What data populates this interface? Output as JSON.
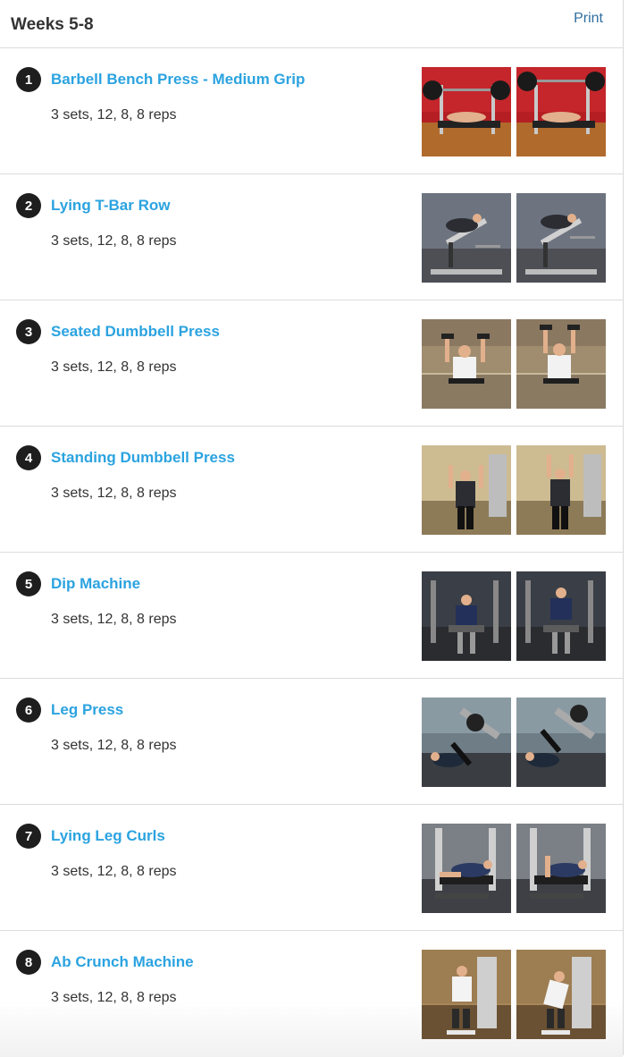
{
  "header": {
    "title": "Weeks 5-8",
    "print_label": "Print"
  },
  "exercises": [
    {
      "number": "1",
      "name": "Barbell Bench Press - Medium Grip",
      "detail": "3 sets, 12, 8, 8 reps",
      "scene": "bench",
      "bg": "#b51f24",
      "floor": "#b06a2c"
    },
    {
      "number": "2",
      "name": "Lying T-Bar Row",
      "detail": "3 sets, 12, 8, 8 reps",
      "scene": "tbar",
      "bg": "#6d7480",
      "floor": "#4d4f55"
    },
    {
      "number": "3",
      "name": "Seated Dumbbell Press",
      "detail": "3 sets, 12, 8, 8 reps",
      "scene": "seated",
      "bg": "#c9b89a",
      "floor": "#8a7a62"
    },
    {
      "number": "4",
      "name": "Standing Dumbbell Press",
      "detail": "3 sets, 12, 8, 8 reps",
      "scene": "standing",
      "bg": "#d3c29c",
      "floor": "#8d7b58"
    },
    {
      "number": "5",
      "name": "Dip Machine",
      "detail": "3 sets, 12, 8, 8 reps",
      "scene": "dip",
      "bg": "#3a3e46",
      "floor": "#2a2c30"
    },
    {
      "number": "6",
      "name": "Leg Press",
      "detail": "3 sets, 12, 8, 8 reps",
      "scene": "legpress",
      "bg": "#6f7d86",
      "floor": "#3a3d42"
    },
    {
      "number": "7",
      "name": "Lying Leg Curls",
      "detail": "3 sets, 12, 8, 8 reps",
      "scene": "legcurl",
      "bg": "#7b7f86",
      "floor": "#3e4045"
    },
    {
      "number": "8",
      "name": "Ab Crunch Machine",
      "detail": "3 sets, 12, 8, 8 reps",
      "scene": "abcrunch",
      "bg": "#a8875a",
      "floor": "#6b5133"
    }
  ]
}
